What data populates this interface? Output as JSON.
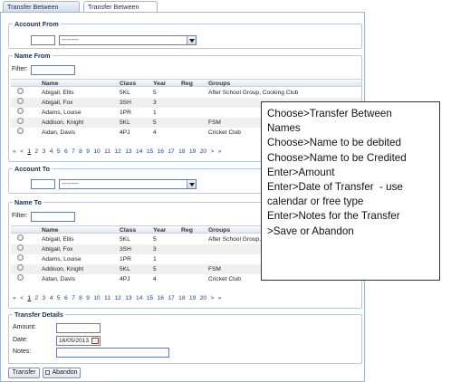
{
  "tabs": [
    {
      "label": "Transfer Between Accounts"
    },
    {
      "label": "Transfer Between Names"
    }
  ],
  "account_from": {
    "title": "Account From",
    "select_value": "--------"
  },
  "name_from": {
    "title": "Name From",
    "filter_label": "Filter:",
    "columns": [
      "Name",
      "Class",
      "Year",
      "Reg",
      "Groups"
    ],
    "rows": [
      {
        "name": "Abigail, Ellis",
        "class": "5KL",
        "year": "5",
        "reg": "",
        "groups": "After School Group, Cooking Club"
      },
      {
        "name": "Abigail, Fox",
        "class": "3SH",
        "year": "3",
        "reg": "",
        "groups": ""
      },
      {
        "name": "Adams, Louise",
        "class": "1PR",
        "year": "1",
        "reg": "",
        "groups": ""
      },
      {
        "name": "Addison, Knight",
        "class": "5KL",
        "year": "5",
        "reg": "",
        "groups": "FSM"
      },
      {
        "name": "Aidan, Davis",
        "class": "4PJ",
        "year": "4",
        "reg": "",
        "groups": "Cricket Club"
      }
    ],
    "pager": {
      "prev_first": "«",
      "prev": "<",
      "pages": [
        "1",
        "2",
        "3",
        "4",
        "5",
        "6",
        "7",
        "8",
        "9",
        "10",
        "11",
        "12",
        "13",
        "14",
        "15",
        "16",
        "17",
        "18",
        "19",
        "20"
      ],
      "next": ">",
      "next_last": "»"
    }
  },
  "account_to": {
    "title": "Account To",
    "select_value": "--------"
  },
  "name_to": {
    "title": "Name To",
    "filter_label": "Filter:",
    "columns": [
      "Name",
      "Class",
      "Year",
      "Reg",
      "Groups"
    ],
    "rows": [
      {
        "name": "Abigail, Ellis",
        "class": "5KL",
        "year": "5",
        "reg": "",
        "groups": "After School Group, Cooking Club"
      },
      {
        "name": "Abigail, Fox",
        "class": "3SH",
        "year": "3",
        "reg": "",
        "groups": ""
      },
      {
        "name": "Adams, Louise",
        "class": "1PR",
        "year": "1",
        "reg": "",
        "groups": ""
      },
      {
        "name": "Addison, Knight",
        "class": "5KL",
        "year": "5",
        "reg": "",
        "groups": "FSM"
      },
      {
        "name": "Aidan, Davis",
        "class": "4PJ",
        "year": "4",
        "reg": "",
        "groups": "Cricket Club"
      }
    ],
    "pager": {
      "prev_first": "«",
      "prev": "<",
      "pages": [
        "1",
        "2",
        "3",
        "4",
        "5",
        "6",
        "7",
        "8",
        "9",
        "10",
        "11",
        "12",
        "13",
        "14",
        "15",
        "16",
        "17",
        "18",
        "19",
        "20"
      ],
      "next": ">",
      "next_last": "»"
    }
  },
  "transfer_details": {
    "title": "Transfer Details",
    "amount_label": "Amount:",
    "amount_value": "",
    "date_label": "Date:",
    "date_value": "16/05/2013",
    "notes_label": "Notes:",
    "notes_value": ""
  },
  "buttons": {
    "transfer": "Transfer",
    "abandon": "Abandon"
  },
  "callout": {
    "lines": [
      "Choose>Transfer Between",
      "Names",
      "Choose>Name to be debited",
      "Choose>Name to be Credited",
      "Enter>Amount",
      "Enter>Date of Transfer  - use",
      "calendar or free type",
      "Enter>Notes for the Transfer",
      ">Save or Abandon"
    ]
  },
  "colors": {
    "tab_border": "#9db6d6",
    "group_border": "#b8c8dd",
    "link_blue": "#1d3f8a",
    "row_alt": "#f0f0f0"
  }
}
